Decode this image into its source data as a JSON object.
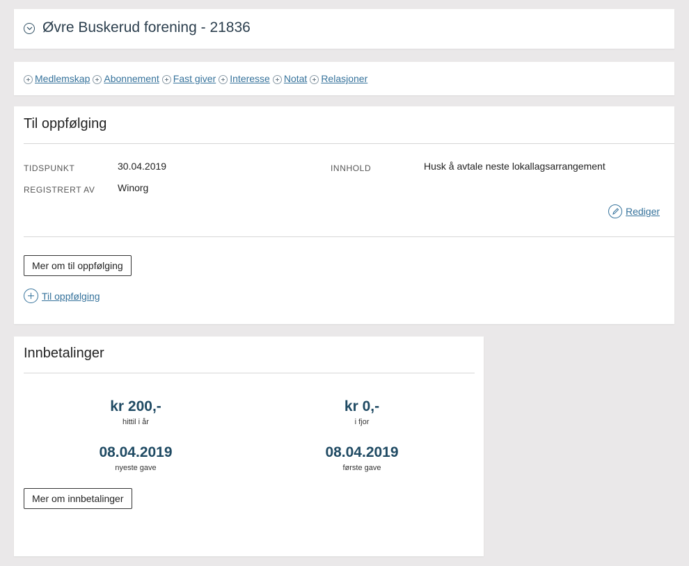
{
  "header": {
    "title": "Øvre Buskerud forening - 21836"
  },
  "quick_links": [
    "Medlemskap",
    "Abonnement",
    "Fast giver",
    "Interesse",
    "Notat",
    "Relasjoner"
  ],
  "followup": {
    "title": "Til oppfølging",
    "tidspunkt_label": "TIDSPUNKT",
    "tidspunkt_value": "30.04.2019",
    "registrert_label": "REGISTRERT AV",
    "registrert_value": "Winorg",
    "innhold_label": "INNHOLD",
    "innhold_value": "Husk å avtale neste lokallagsarrangement",
    "edit_label": "Rediger",
    "more_button": "Mer om til oppfølging",
    "add_label": "Til oppfølging"
  },
  "payments": {
    "title": "Innbetalinger",
    "this_year_amount": "kr 200,-",
    "this_year_caption": "hittil i år",
    "last_year_amount": "kr 0,-",
    "last_year_caption": "i fjor",
    "newest_gift_date": "08.04.2019",
    "newest_gift_caption": "nyeste gave",
    "first_gift_date": "08.04.2019",
    "first_gift_caption": "første gave",
    "more_button": "Mer om innbetalinger"
  },
  "colors": {
    "background": "#eae8e9",
    "link": "#35729b",
    "stat_number": "#1f4a63"
  }
}
